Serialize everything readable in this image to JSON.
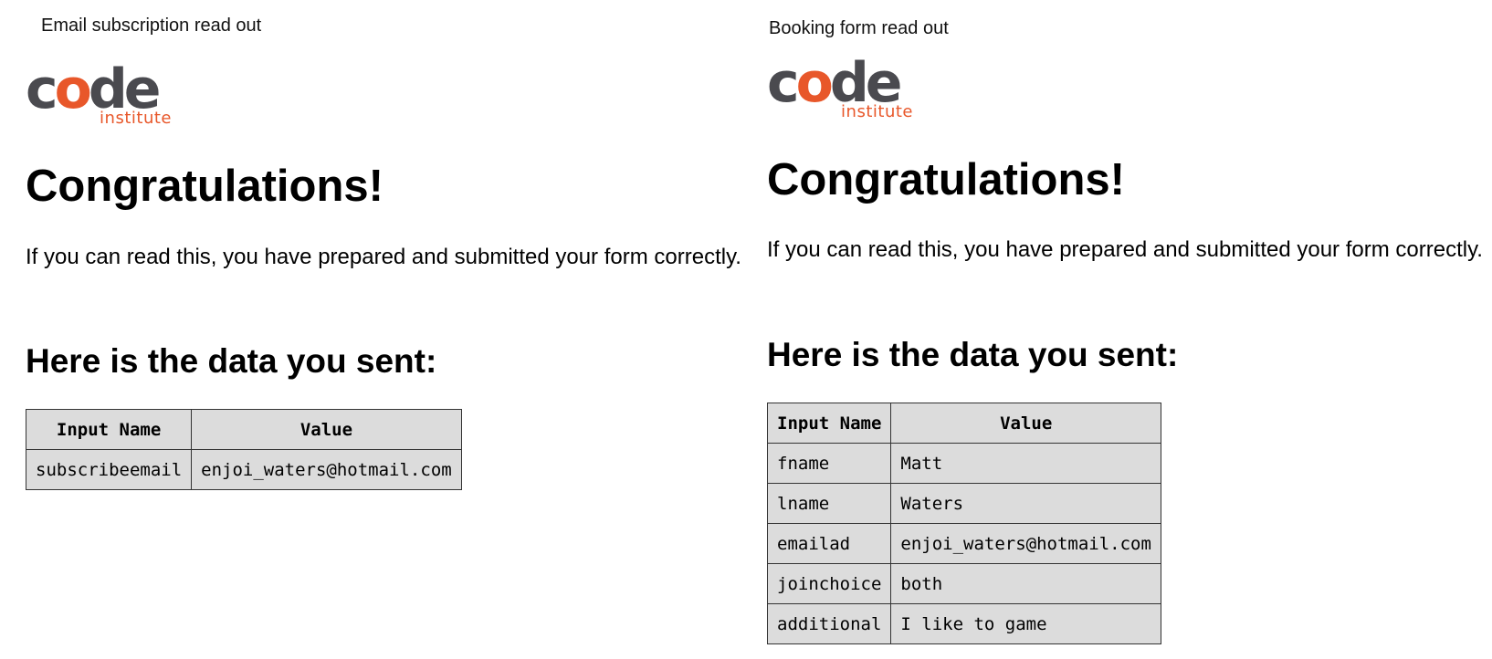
{
  "left": {
    "caption": "Email subscription read out",
    "logo": {
      "code_prefix": "c",
      "code_o": "o",
      "code_suffix": "de",
      "sub": "institute"
    },
    "heading": "Congratulations!",
    "intro": "If you can read this, you have prepared and submitted your form correctly.",
    "data_heading": "Here is the data you sent:",
    "table": {
      "headers": [
        "Input Name",
        "Value"
      ],
      "rows": [
        [
          "subscribeemail",
          "enjoi_waters@hotmail.com"
        ]
      ]
    }
  },
  "right": {
    "caption": "Booking form read out",
    "logo": {
      "code_prefix": "c",
      "code_o": "o",
      "code_suffix": "de",
      "sub": "institute"
    },
    "heading": "Congratulations!",
    "intro": "If you can read this, you have prepared and submitted your form correctly.",
    "data_heading": "Here is the data you sent:",
    "table": {
      "headers": [
        "Input Name",
        "Value"
      ],
      "rows": [
        [
          "fname",
          "Matt"
        ],
        [
          "lname",
          "Waters"
        ],
        [
          "emailad",
          "enjoi_waters@hotmail.com"
        ],
        [
          "joinchoice",
          "both"
        ],
        [
          "additional",
          "I like to game"
        ]
      ]
    }
  },
  "colors": {
    "logo_gray": "#4a4a4f",
    "logo_orange": "#e8572a",
    "table_bg": "#dcdcdc"
  }
}
